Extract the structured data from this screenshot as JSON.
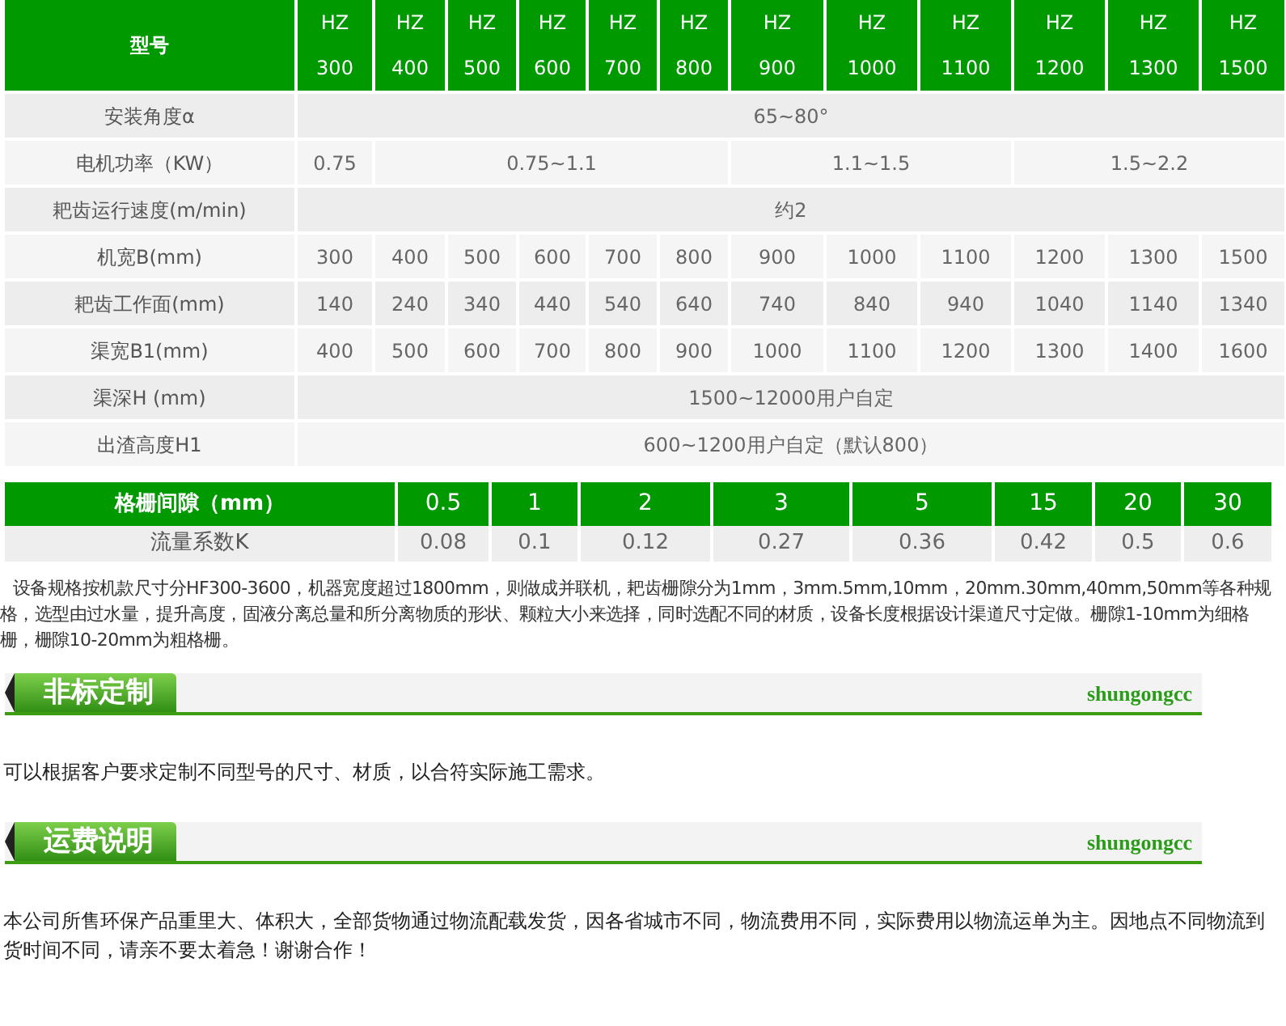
{
  "spec_table": {
    "header_label": "型号",
    "models": [
      {
        "line1": "HZ",
        "line2": "300"
      },
      {
        "line1": "HZ",
        "line2": "400"
      },
      {
        "line1": "HZ",
        "line2": "500"
      },
      {
        "line1": "HZ",
        "line2": "600"
      },
      {
        "line1": "HZ",
        "line2": "700"
      },
      {
        "line1": "HZ",
        "line2": "800"
      },
      {
        "line1": "HZ",
        "line2": "900"
      },
      {
        "line1": "HZ",
        "line2": "1000"
      },
      {
        "line1": "HZ",
        "line2": "1100"
      },
      {
        "line1": "HZ",
        "line2": "1200"
      },
      {
        "line1": "HZ",
        "line2": "1300"
      },
      {
        "line1": "HZ",
        "line2": "1500"
      }
    ],
    "rows": [
      {
        "label": "安装角度α",
        "cells": [
          {
            "text": "65~80°",
            "colspan": 12
          }
        ]
      },
      {
        "label": "电机功率（KW）",
        "cells": [
          "0.75",
          {
            "text": "0.75~1.1",
            "colspan": 5
          },
          {
            "text": "1.1~1.5",
            "colspan": 3
          },
          {
            "text": "1.5~2.2",
            "colspan": 3
          }
        ]
      },
      {
        "label": "耙齿运行速度(m/min)",
        "cells": [
          {
            "text": "约2",
            "colspan": 12
          }
        ]
      },
      {
        "label": "机宽B(mm)",
        "cells": [
          "300",
          "400",
          "500",
          "600",
          "700",
          "800",
          "900",
          "1000",
          "1100",
          "1200",
          "1300",
          "1500"
        ]
      },
      {
        "label": "耙齿工作面(mm)",
        "cells": [
          "140",
          "240",
          "340",
          "440",
          "540",
          "640",
          "740",
          "840",
          "940",
          "1040",
          "1140",
          "1340"
        ]
      },
      {
        "label": "渠宽B1(mm)",
        "cells": [
          "400",
          "500",
          "600",
          "700",
          "800",
          "900",
          "1000",
          "1100",
          "1200",
          "1300",
          "1400",
          "1600"
        ]
      },
      {
        "label": "渠深H (mm)",
        "cells": [
          {
            "text": "1500~12000用户自定",
            "colspan": 12
          }
        ]
      },
      {
        "label": "出渣高度H1",
        "cells": [
          {
            "text": "600~1200用户自定（默认800）",
            "colspan": 12
          }
        ]
      }
    ]
  },
  "gap_table": {
    "header_label": "格栅间隙（mm）",
    "row_label": "流量系数K",
    "columns": [
      {
        "gap": "0.5",
        "flow": "0.08"
      },
      {
        "gap": "1",
        "flow": "0.1"
      },
      {
        "gap": "2",
        "flow": "0.12"
      },
      {
        "gap": "3",
        "flow": "0.27"
      },
      {
        "gap": "5",
        "flow": "0.36"
      },
      {
        "gap": "15",
        "flow": "0.42"
      },
      {
        "gap": "20",
        "flow": "0.5"
      },
      {
        "gap": "30",
        "flow": "0.6"
      }
    ]
  },
  "note": "设备规格按机款尺寸分HF300-3600，机器宽度超过1800mm，则做成并联机，耙齿栅隙分为1mm，3mm.5mm,10mm，20mm.30mm,40mm,50mm等各种规格，选型由过水量，提升高度，固液分离总量和所分离物质的形状、颗粒大小来选择，同时选配不同的材质，设备长度根据设计渠道尺寸定做。栅隙1-10mm为细格栅，栅隙10-20mm为粗格栅。",
  "sections": [
    {
      "title": "非标定制",
      "brand": "shungongcc",
      "body": "可以根据客户要求定制不同型号的尺寸、材质，以合符实际施工需求。"
    },
    {
      "title": "运费说明",
      "brand": "shungongcc",
      "body": "本公司所售环保产品重里大、体积大，全部货物通过物流配载发货，因各省城市不同，物流费用不同，实际费用以物流运单为主。因地点不同物流到货时间不同，请亲不要太着急！谢谢合作！"
    }
  ]
}
